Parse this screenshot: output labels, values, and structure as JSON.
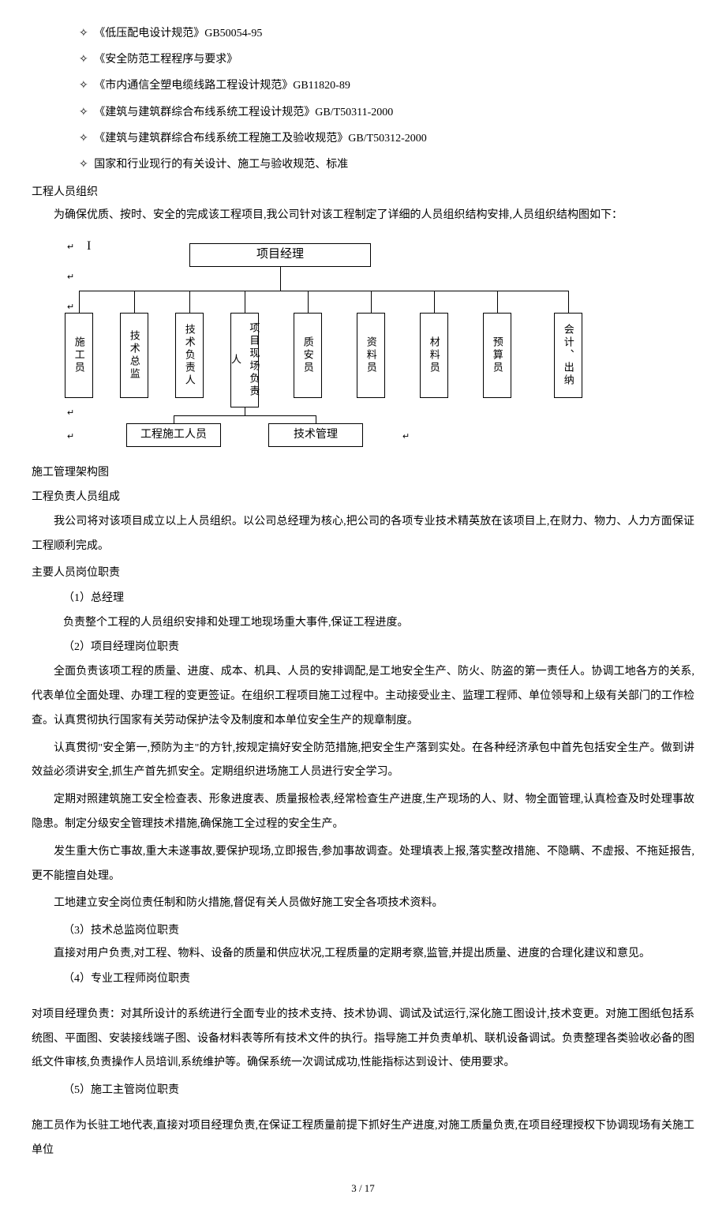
{
  "bullets": [
    "《低压配电设计规范》GB50054-95",
    "《安全防范工程程序与要求》",
    "《市内通信全塑电缆线路工程设计规范》GB11820-89",
    "《建筑与建筑群综合布线系统工程设计规范》GB/T50311-2000",
    "《建筑与建筑群综合布线系统工程施工及验收规范》GB/T50312-2000",
    "国家和行业现行的有关设计、施工与验收规范、标准"
  ],
  "sec1_title": "工程人员组织",
  "sec1_intro": "为确保优质、按时、安全的完成该工程项目,我公司针对该工程制定了详细的人员组织结构安排,人员组织结构图如下：",
  "chart": {
    "top": "项目经理",
    "roles": [
      "施工员",
      "技术总监",
      "技术负责人",
      "项目现场负责人",
      "质安员",
      "资料员",
      "材料员",
      "预算员",
      "会计、出纳"
    ],
    "bottom_left": "工程施工人员",
    "bottom_right": "技术管理"
  },
  "sec2_title": "施工管理架构图",
  "sec3_title": "工程负责人员组成",
  "sec3_body": "我公司将对该项目成立以上人员组织。以公司总经理为核心,把公司的各项专业技术精英放在该项目上,在财力、物力、人力方面保证工程顺利完成。",
  "sec4_title": "主要人员岗位职责",
  "items": {
    "i1_label": "（1）总经理",
    "i1_body": "负责整个工程的人员组织安排和处理工地现场重大事件,保证工程进度。",
    "i2_label": "（2）项目经理岗位职责",
    "i2_p1": "全面负责该项工程的质量、进度、成本、机具、人员的安排调配,是工地安全生产、防火、防盗的第一责任人。协调工地各方的关系,代表单位全面处理、办理工程的变更签证。在组织工程项目施工过程中。主动接受业主、监理工程师、单位领导和上级有关部门的工作检查。认真贯彻执行国家有关劳动保护法令及制度和本单位安全生产的规章制度。",
    "i2_p2": "认真贯彻\"安全第一,预防为主\"的方针,按规定搞好安全防范措施,把安全生产落到实处。在各种经济承包中首先包括安全生产。做到讲效益必须讲安全,抓生产首先抓安全。定期组织进场施工人员进行安全学习。",
    "i2_p3": "定期对照建筑施工安全检查表、形象进度表、质量报检表,经常检查生产进度,生产现场的人、财、物全面管理,认真检查及时处理事故隐患。制定分级安全管理技术措施,确保施工全过程的安全生产。",
    "i2_p4": "发生重大伤亡事故,重大未遂事故,要保护现场,立即报告,参加事故调查。处理填表上报,落实整改措施、不隐瞒、不虚报、不拖延报告,更不能擅自处理。",
    "i2_p5": "工地建立安全岗位责任制和防火措施,督促有关人员做好施工安全各项技术资料。",
    "i3_label": "（3）技术总监岗位职责",
    "i3_body": "直接对用户负责,对工程、物料、设备的质量和供应状况,工程质量的定期考察,监管,并提出质量、进度的合理化建议和意见。",
    "i4_label": "（4）专业工程师岗位职责",
    "i4_body": "对项目经理负责：对其所设计的系统进行全面专业的技术支持、技术协调、调试及试运行,深化施工图设计,技术变更。对施工图纸包括系统图、平面图、安装接线端子图、设备材料表等所有技术文件的执行。指导施工并负责单机、联机设备调试。负责整理各类验收必备的图纸文件审核,负责操作人员培训,系统维护等。确保系统一次调试成功,性能指标达到设计、使用要求。",
    "i5_label": "（5）施工主管岗位职责",
    "i5_body": "施工员作为长驻工地代表,直接对项目经理负责,在保证工程质量前提下抓好生产进度,对施工质量负责,在项目经理授权下协调现场有关施工单位"
  },
  "footer": "3 / 17"
}
